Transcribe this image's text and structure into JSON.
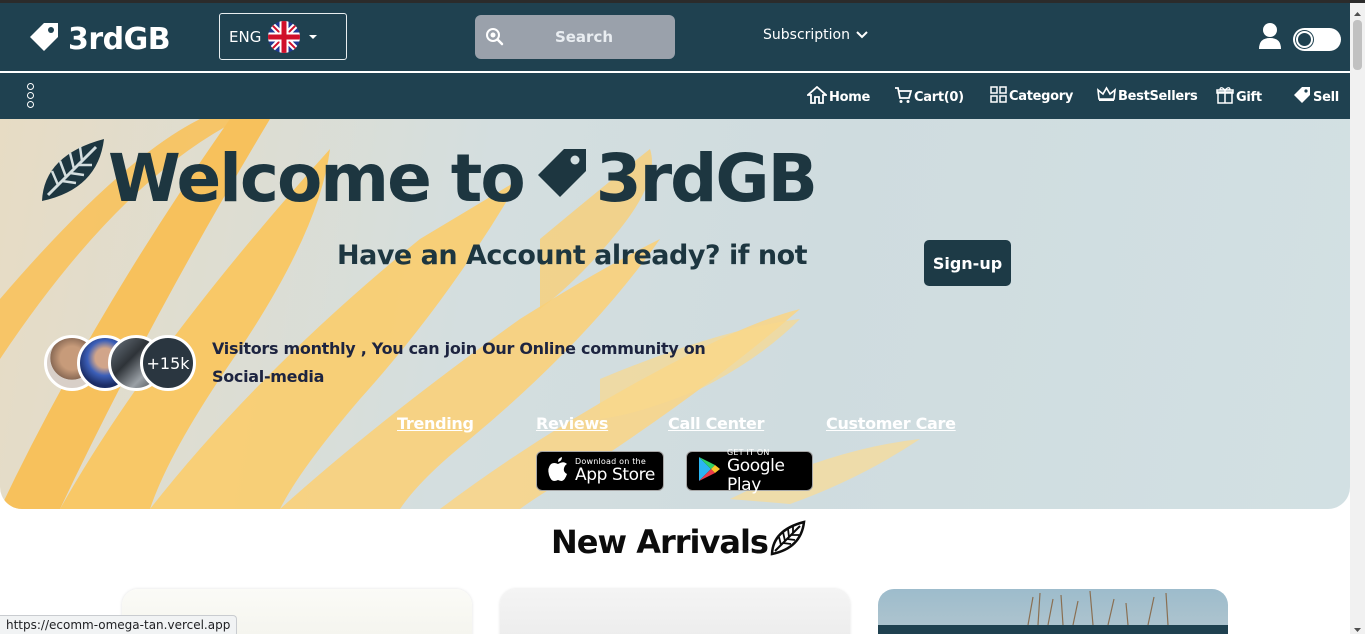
{
  "header": {
    "logo_text": "3rdGB",
    "language_code": "ENG",
    "search_placeholder": "Search",
    "subscription_label": "Subscription"
  },
  "nav": {
    "items": [
      {
        "label": "Home",
        "icon": "home-icon"
      },
      {
        "label": "Cart(0)",
        "icon": "cart-icon"
      },
      {
        "label": "Category",
        "icon": "grid-icon"
      },
      {
        "label": "BestSellers",
        "icon": "crown-icon"
      },
      {
        "label": "Gift",
        "icon": "gift-icon"
      },
      {
        "label": "Sell",
        "icon": "tag-icon"
      }
    ]
  },
  "hero": {
    "welcome_prefix": "Welcome to",
    "welcome_brand": "3rdGB",
    "account_prompt": "Have an Account already? if not",
    "signup_label": "Sign-up",
    "avatar_more": "+15k",
    "visitors_text": "Visitors monthly , You can join Our Online community on Social-media",
    "links": [
      "Trending",
      "Reviews",
      "Call Center",
      "Customer Care"
    ],
    "app_store": {
      "small": "Download on the",
      "big": "App Store"
    },
    "google_play": {
      "small": "GET IT ON",
      "big": "Google Play"
    }
  },
  "arrivals": {
    "title": "New Arrivals"
  },
  "status_bar": {
    "url": "https://ecomm-omega-tan.vercel.app"
  },
  "colors": {
    "primary": "#1f4150",
    "dark_text": "#1d3640",
    "accent_yellow": "#f7c15c"
  }
}
